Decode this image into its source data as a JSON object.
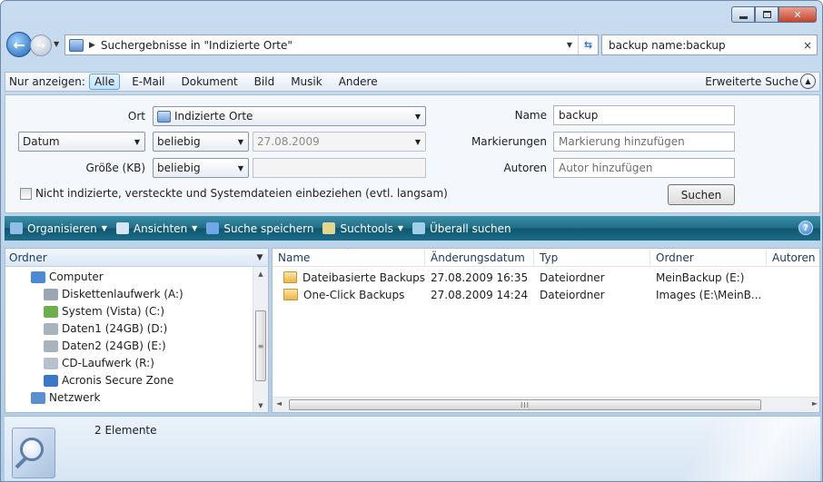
{
  "window": {
    "caption": {
      "minimize_icon": "minimize-icon",
      "maximize_icon": "maximize-icon",
      "close_glyph": "✕"
    }
  },
  "address": {
    "breadcrumb": "Suchergebnisse in \"Indizierte Orte\"",
    "search_value": "backup name:backup",
    "clear_glyph": "×"
  },
  "filter_bar": {
    "label": "Nur anzeigen:",
    "items": [
      "Alle",
      "E-Mail",
      "Dokument",
      "Bild",
      "Musik",
      "Andere"
    ],
    "active": "Alle",
    "advanced_label": "Erweiterte Suche"
  },
  "advanced": {
    "ort_label": "Ort",
    "ort_value": "Indizierte Orte",
    "datum_value": "Datum",
    "datum_qualifier": "beliebig",
    "datum_date": "27.08.2009",
    "groesse_label": "Größe (KB)",
    "groesse_qualifier": "beliebig",
    "groesse_value": "",
    "include_label": "Nicht indizierte, versteckte und Systemdateien einbeziehen (evtl. langsam)",
    "name_label": "Name",
    "name_value": "backup",
    "tags_label": "Markierungen",
    "tags_placeholder": "Markierung hinzufügen",
    "authors_label": "Autoren",
    "authors_placeholder": "Autor hinzufügen",
    "search_button": "Suchen"
  },
  "command_bar": {
    "items": [
      {
        "label": "Organisieren",
        "dropdown": true,
        "icon": "organize-icon",
        "color": "#8fbde8"
      },
      {
        "label": "Ansichten",
        "dropdown": true,
        "icon": "views-icon",
        "color": "#d7e6f5"
      },
      {
        "label": "Suche speichern",
        "dropdown": false,
        "icon": "save-search-icon",
        "color": "#6fa8e8"
      },
      {
        "label": "Suchtools",
        "dropdown": true,
        "icon": "search-tools-icon",
        "color": "#e6d58f"
      },
      {
        "label": "Überall suchen",
        "dropdown": false,
        "icon": "search-everywhere-icon",
        "color": "#9fd0e8"
      }
    ],
    "help_glyph": "?"
  },
  "nav_pane": {
    "header": "Ordner",
    "items": [
      {
        "label": "Computer",
        "icon": "computer-icon",
        "color": "#4d8ad6"
      },
      {
        "label": "Diskettenlaufwerk (A:)",
        "icon": "floppy-drive-icon",
        "color": "#9aa6b4"
      },
      {
        "label": "System (Vista) (C:)",
        "icon": "system-drive-icon",
        "color": "#6fae4f"
      },
      {
        "label": "Daten1 (24GB) (D:)",
        "icon": "hard-drive-icon",
        "color": "#a9b3bd"
      },
      {
        "label": "Daten2 (24GB) (E:)",
        "icon": "hard-drive-icon",
        "color": "#a9b3bd"
      },
      {
        "label": "CD-Laufwerk (R:)",
        "icon": "cd-drive-icon",
        "color": "#b8c2cc"
      },
      {
        "label": "Acronis Secure Zone",
        "icon": "acronis-zone-icon",
        "color": "#3a78c8"
      },
      {
        "label": "Netzwerk",
        "icon": "network-icon",
        "color": "#5a8fd0"
      }
    ],
    "scroll_up": "▲",
    "scroll_down": "▼",
    "scroll_grip": "≡"
  },
  "file_list": {
    "columns": [
      "Name",
      "Änderungsdatum",
      "Typ",
      "Ordner",
      "Autoren"
    ],
    "sort_indicator": "^",
    "rows": [
      {
        "name": "Dateibasierte Backups",
        "date": "27.08.2009 16:35",
        "type": "Dateiordner",
        "folder": "MeinBackup (E:)"
      },
      {
        "name": "One-Click Backups",
        "date": "27.08.2009 14:24",
        "type": "Dateiordner",
        "folder": "Images (E:\\MeinB..."
      }
    ],
    "hscroll_left": "◄",
    "hscroll_right": "►",
    "hscroll_grip": "III"
  },
  "details": {
    "count": "2 Elemente"
  }
}
